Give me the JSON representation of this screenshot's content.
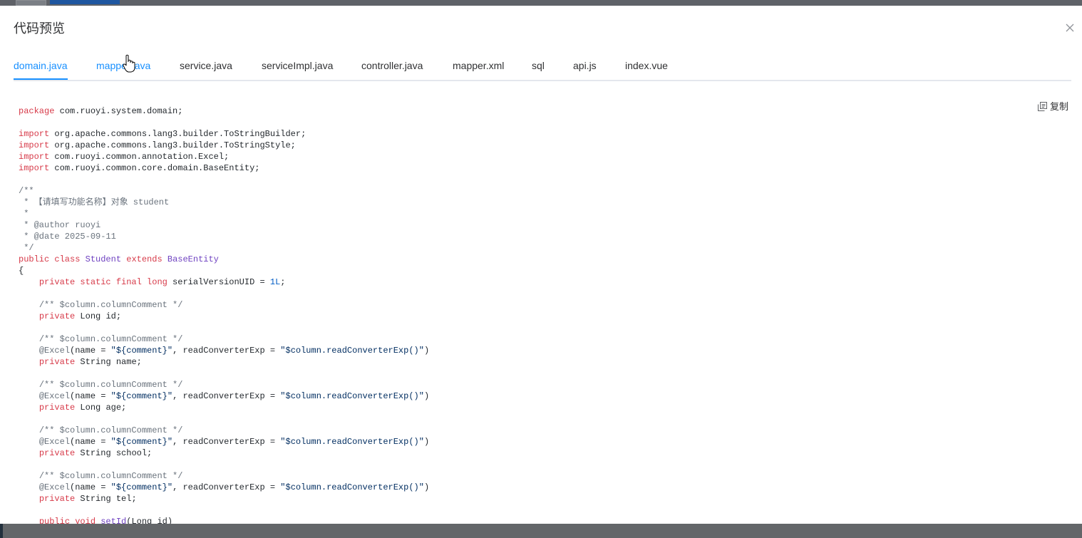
{
  "dialog": {
    "title": "代码预览",
    "copy_label": "复制",
    "tabs": [
      {
        "label": "domain.java",
        "active": true
      },
      {
        "label": "mapper.java"
      },
      {
        "label": "service.java"
      },
      {
        "label": "serviceImpl.java"
      },
      {
        "label": "controller.java"
      },
      {
        "label": "mapper.xml"
      },
      {
        "label": "sql"
      },
      {
        "label": "api.js"
      },
      {
        "label": "index.vue"
      }
    ]
  },
  "code": {
    "l01a": "package",
    "l01b": " com.ruoyi.system.domain;",
    "l03b": " org.apache.commons.lang3.builder.ToStringBuilder;",
    "l04b": " org.apache.commons.lang3.builder.ToStringStyle;",
    "l05b": " com.ruoyi.common.annotation.Excel;",
    "l06b": " com.ruoyi.common.core.domain.BaseEntity;",
    "kw_import": "import",
    "l08": "/**",
    "l09": " * 【请填写功能名称】对象 student",
    "l10": " *",
    "l11": " * @author ruoyi",
    "l12": " * @date 2025-09-11",
    "l13": " */",
    "l14a": "public class",
    "l14b": "Student",
    "l14c": "extends",
    "l14d": "BaseEntity",
    "l15": "{",
    "l16a": "private static final long",
    "l16b": " serialVersionUID = ",
    "l16c": "1L",
    "l16d": ";",
    "col_comment": "/** $column.columnComment */",
    "kw_private": "private",
    "excel_anno": "@Excel",
    "excel_args_a": "(name = ",
    "excel_args_b": "\"${comment}\"",
    "excel_args_c": ", readConverterExp = ",
    "excel_args_d": "\"$column.readConverterExp()\"",
    "excel_args_e": ")",
    "f_id": " Long id;",
    "f_name": " String name;",
    "f_age": " Long age;",
    "f_school": " String school;",
    "f_tel": " String tel;",
    "l37a": "public void",
    "l37b": "setId",
    "l37c": "(Long id)"
  }
}
